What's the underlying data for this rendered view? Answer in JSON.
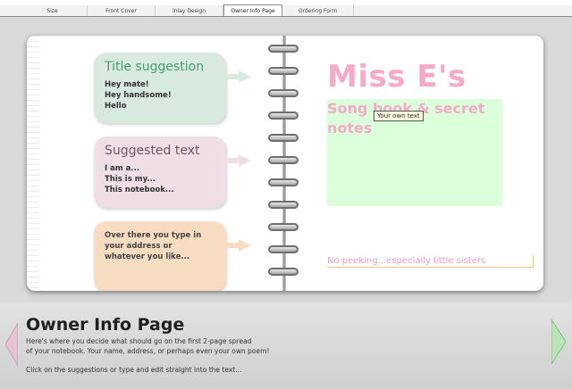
{
  "tabs": [
    {
      "label": "Size",
      "active": false
    },
    {
      "label": "Front Cover",
      "active": false
    },
    {
      "label": "Inlay Design",
      "active": false
    },
    {
      "label": "Owner Info Page",
      "active": true
    },
    {
      "label": "Ordering Form",
      "active": false
    }
  ],
  "suggestions": {
    "title": {
      "heading": "Title suggestion",
      "lines": [
        "Hey mate!",
        "Hey handsome!",
        "Hello"
      ]
    },
    "text": {
      "heading": "Suggested text",
      "lines": [
        "I am a...",
        "This is my...",
        "This notebook..."
      ]
    },
    "address": {
      "lines": [
        "Over there you type in",
        "your address or",
        "whatever you like..."
      ]
    }
  },
  "page": {
    "owner_title": "Miss E's",
    "subtitle_lines": [
      "Song book & secret",
      "notes"
    ],
    "tooltip": "Your own text",
    "footer_text": "No peeking...especially little sisters"
  },
  "info": {
    "title": "Owner Info Page",
    "desc_line1": "Here's where you decide what should go on the first 2-page spread",
    "desc_line2": "of your notebook. Your name, address, or perhaps even your own poem!",
    "desc_line3": "Click on the suggestions or type and edit straight into the text..."
  },
  "colors": {
    "title_green": "#4a9c74",
    "pink_text": "#f7a9c8",
    "green_box": "#dbffdb"
  },
  "icons": {
    "left": "arrow-left-icon",
    "right": "arrow-right-icon"
  }
}
